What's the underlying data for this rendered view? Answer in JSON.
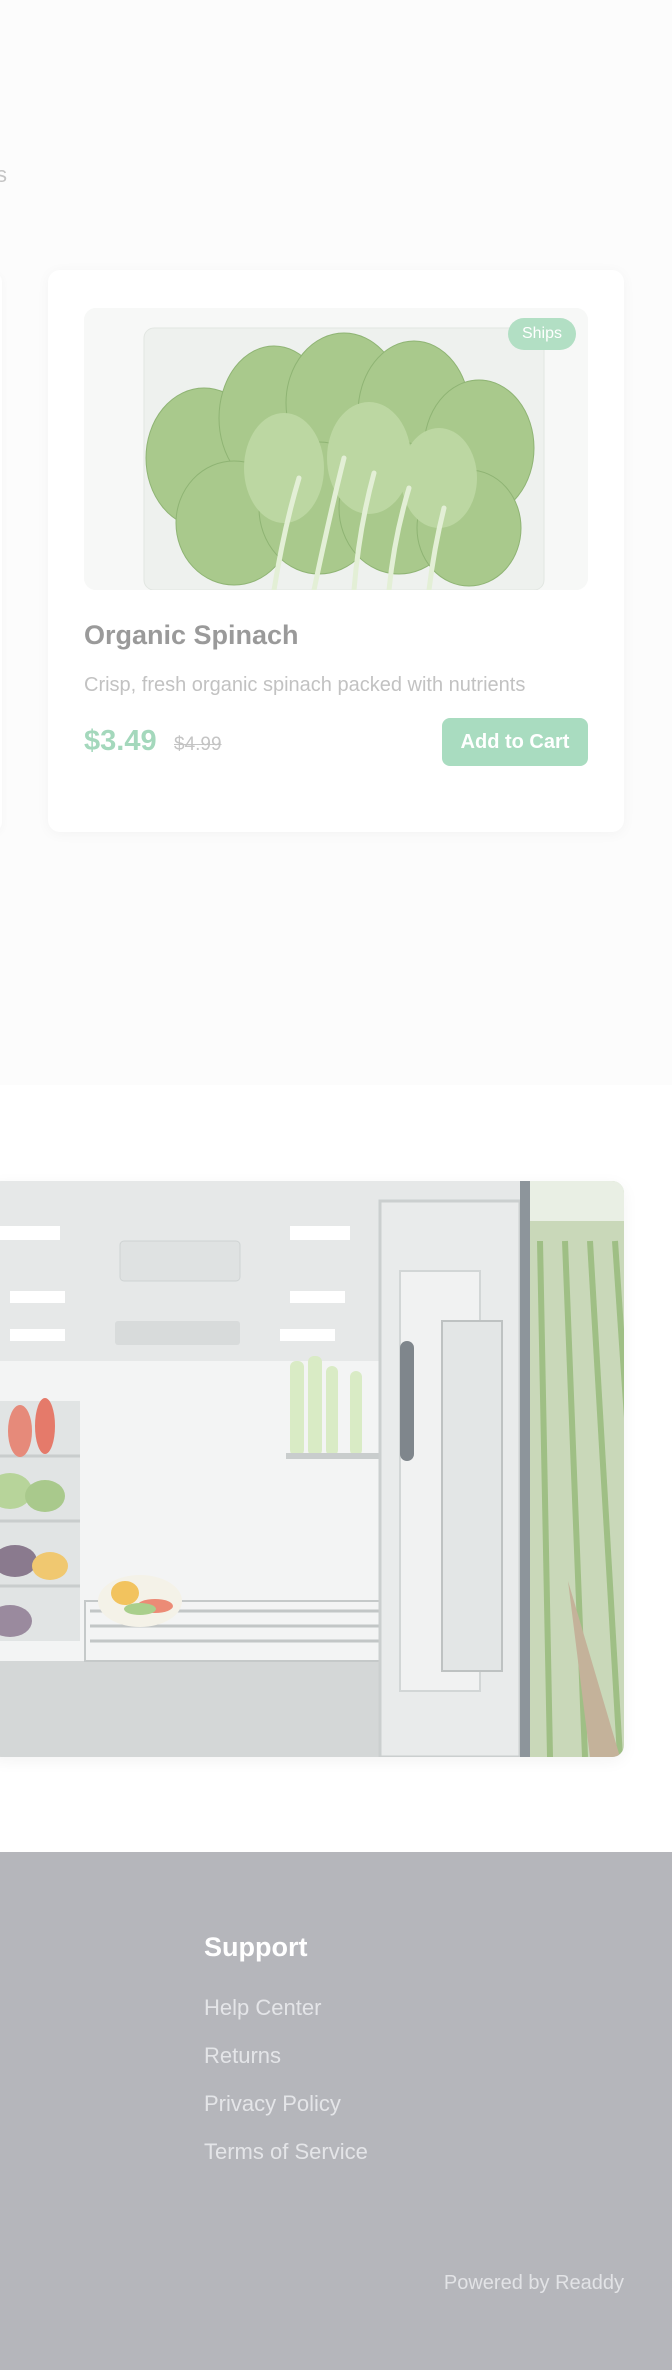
{
  "product_section": {
    "cut_text": "s",
    "product": {
      "badge": "Ships",
      "name": "Organic Spinach",
      "description": "Crisp, fresh organic spinach packed with nutrients",
      "price": "$3.49",
      "old_price": "$4.99",
      "add_to_cart_label": "Add to Cart"
    }
  },
  "footer": {
    "support_heading": "Support",
    "links": [
      "Help Center",
      "Returns",
      "Privacy Policy",
      "Terms of Service"
    ],
    "powered_by": "Powered by Readdy"
  },
  "colors": {
    "accent_green": "#a9dcc0",
    "footer_bg": "#b5b6bb"
  }
}
